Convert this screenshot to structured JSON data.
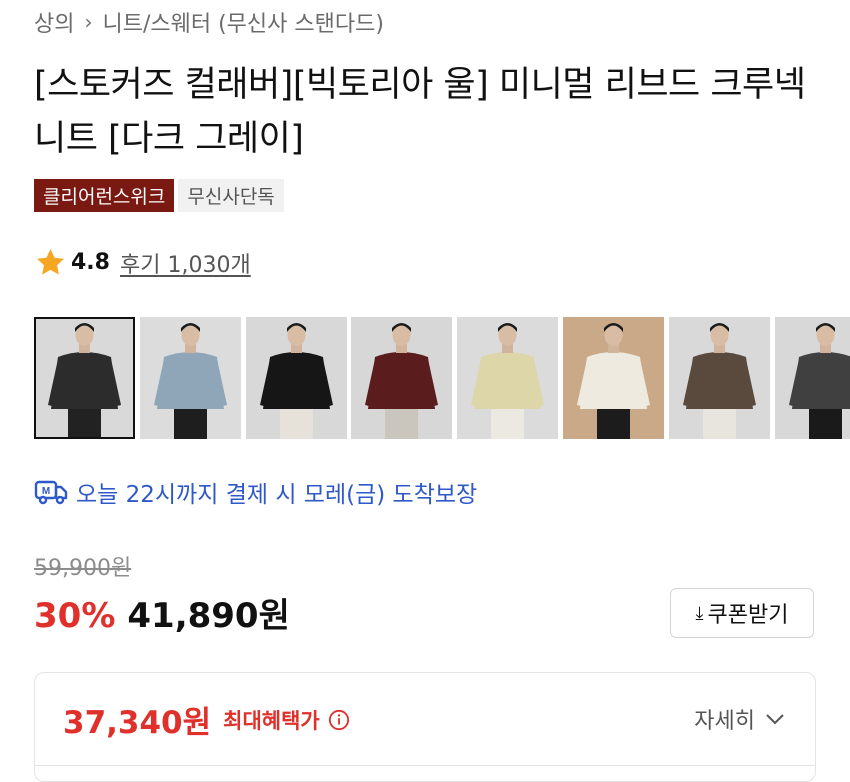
{
  "breadcrumb": {
    "category": "상의",
    "subcategory": "니트/스웨터 (무신사 스탠다드)"
  },
  "product": {
    "title": "[스토커즈 컬래버][빅토리아 울] 미니멀 리브드 크루넥 니트 [다크 그레이]",
    "badges": [
      "클리어런스위크",
      "무신사단독"
    ],
    "rating": "4.8",
    "reviews": "후기 1,030개"
  },
  "thumbnails": [
    {
      "name": "dark-gray",
      "bg": "#d9d9d9",
      "sweater": "#2c2c2c",
      "pants": "#222222",
      "selected": true
    },
    {
      "name": "sky-blue",
      "bg": "#dcdcdc",
      "sweater": "#8fa6b8",
      "pants": "#1e1e1e",
      "selected": false
    },
    {
      "name": "black",
      "bg": "#d8d8d8",
      "sweater": "#161616",
      "pants": "#e6e2da",
      "selected": false
    },
    {
      "name": "burgundy",
      "bg": "#d7d7d7",
      "sweater": "#5b1c1e",
      "pants": "#cbc6bd",
      "selected": false
    },
    {
      "name": "light-yellow",
      "bg": "#dbdbdb",
      "sweater": "#dcd6a8",
      "pants": "#ece9e2",
      "selected": false
    },
    {
      "name": "ivory",
      "bg": "#c9a987",
      "sweater": "#eeeae0",
      "pants": "#1c1c1c",
      "selected": false
    },
    {
      "name": "brown",
      "bg": "#d9d9d9",
      "sweater": "#5a4a3e",
      "pants": "#e8e5de",
      "selected": false
    },
    {
      "name": "charcoal",
      "bg": "#d8d8d8",
      "sweater": "#404040",
      "pants": "#1a1a1a",
      "selected": false
    }
  ],
  "delivery": {
    "text": "오늘 22시까지 결제 시 모레(금) 도착보장",
    "icon": "delivery-truck-icon",
    "color": "#2f59c9"
  },
  "pricing": {
    "original": "59,900원",
    "discount": "30%",
    "sale": "41,890원",
    "coupon_label": "쿠폰받기",
    "accent": "#e0302b"
  },
  "benefit": {
    "price": "37,340원",
    "label": "최대혜택가",
    "detail": "자세히"
  }
}
